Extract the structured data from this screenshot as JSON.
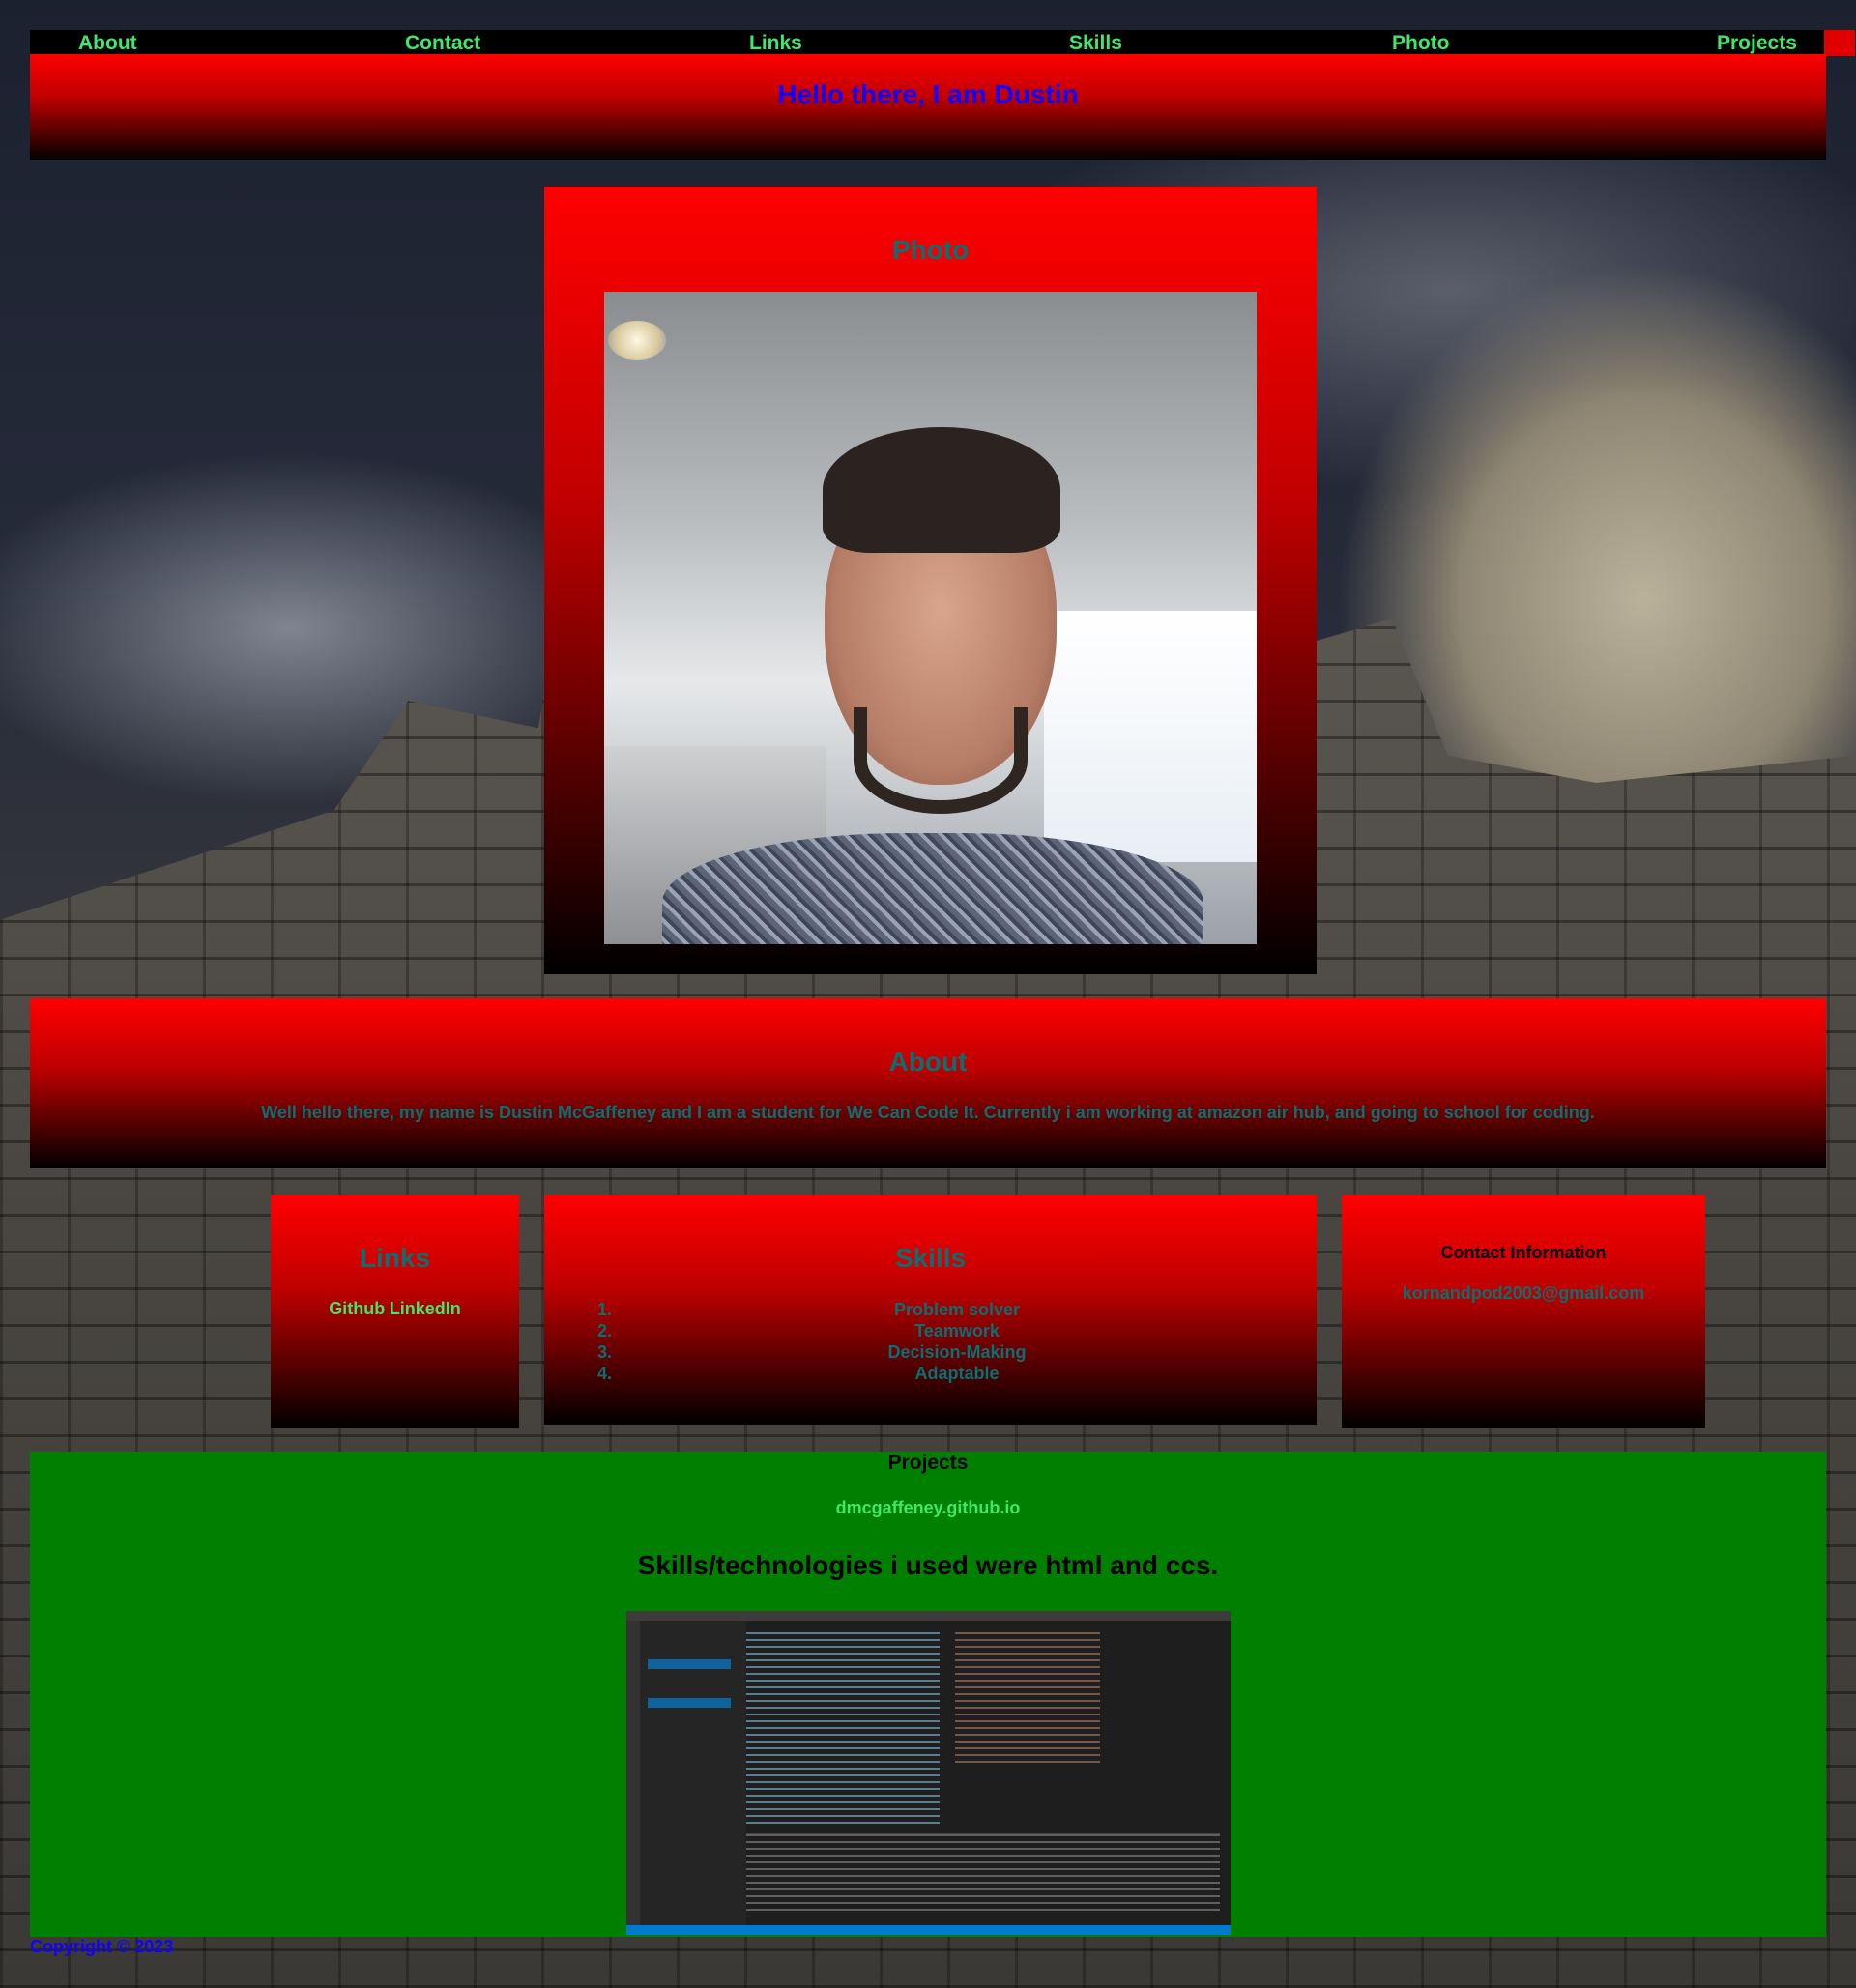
{
  "nav": {
    "items": [
      "About",
      "Contact",
      "Links",
      "Skills",
      "Photo",
      "Projects"
    ]
  },
  "header": {
    "title": "Hello there, I am Dustin"
  },
  "photo": {
    "heading": "Photo"
  },
  "about": {
    "heading": "About",
    "text": "Well hello there, my name is Dustin McGaffeney and I am a student for We Can Code It. Currently i am working at amazon air hub, and going to school for coding."
  },
  "links": {
    "heading": "Links",
    "github": "Github",
    "linkedin": "LinkedIn"
  },
  "skills": {
    "heading": "Skills",
    "items": [
      {
        "num": "1.",
        "label": "Problem solver"
      },
      {
        "num": "2.",
        "label": "Teamwork"
      },
      {
        "num": "3.",
        "label": "Decision-Making"
      },
      {
        "num": "4.",
        "label": "Adaptable"
      }
    ]
  },
  "contact": {
    "heading": "Contact Information",
    "email": "kornandpod2003@gmail.com"
  },
  "projects": {
    "heading": "Projects",
    "link": "dmcgaffeney.github.io",
    "stack_text": "Skills/technologies i used were html and ccs."
  },
  "footer": {
    "copyright": "Copyright © 2023"
  },
  "colors": {
    "nav_link": "#3ee86a",
    "header_title": "#1200ff",
    "section_text": "#0a6f72",
    "projects_bg": "#007f00",
    "box_gradient_top": "#ff0000",
    "box_gradient_bottom": "#000000"
  }
}
